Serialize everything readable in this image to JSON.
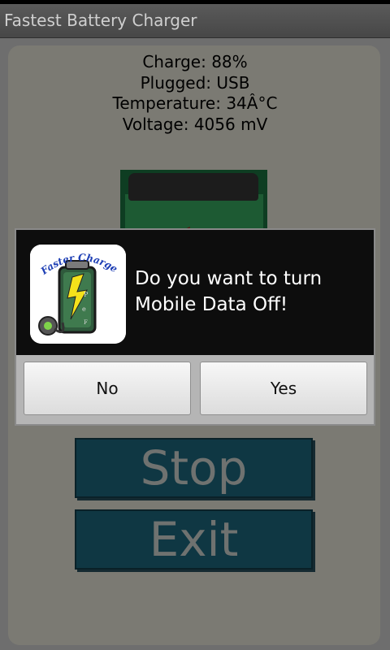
{
  "app": {
    "title": "Fastest Battery Charger"
  },
  "stats": {
    "charge": "Charge: 88%",
    "plugged": "Plugged: USB",
    "temperature": "Temperature: 34Â°C",
    "voltage": "Voltage: 4056 mV"
  },
  "dialog": {
    "message_line1": "Do you want to turn",
    "message_line2": "Mobile Data Off!",
    "icon_text": "Faster Charger",
    "no_label": "No",
    "yes_label": "Yes"
  },
  "buttons": {
    "stop_label": "Stop",
    "exit_label": "Exit"
  },
  "icons": {
    "app_icon": "battery-lightning-icon",
    "battery_graphic": "battery-icon"
  },
  "colors": {
    "titlebar": "#4f4f4f",
    "panel": "#7b7a73",
    "big_button_bg": "#0f3743",
    "dialog_bg": "#0d0d0d",
    "dialog_button_bg": "#e8e8e8"
  }
}
